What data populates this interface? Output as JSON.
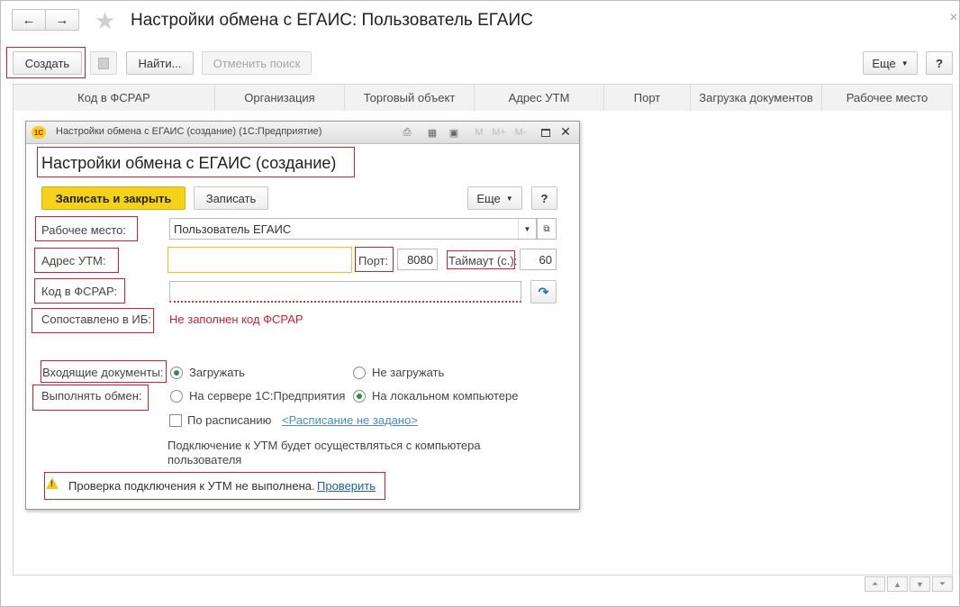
{
  "window": {
    "title": "Настройки обмена с ЕГАИС: Пользователь ЕГАИС"
  },
  "nav": {
    "back_glyph": "←",
    "forward_glyph": "→",
    "star_glyph": "★"
  },
  "toolbar": {
    "create": "Создать",
    "find": "Найти...",
    "cancel_search": "Отменить поиск",
    "more": "Еще",
    "help": "?"
  },
  "list": {
    "columns": [
      "Код в ФСРАР",
      "Организация",
      "Торговый объект",
      "Адрес УТМ",
      "Порт",
      "Загрузка документов",
      "Рабочее место"
    ]
  },
  "dialog": {
    "window_title": "Настройки обмена с ЕГАИС (создание)  (1С:Предприятие)",
    "heading": "Настройки обмена с ЕГАИС (создание)",
    "toolbar": {
      "save_close": "Записать и закрыть",
      "save": "Записать",
      "more": "Еще",
      "help": "?"
    },
    "workplace": {
      "label": "Рабочее место:",
      "value": "Пользователь ЕГАИС"
    },
    "utm": {
      "label": "Адрес УТМ:",
      "value": "",
      "port_label": "Порт:",
      "port": "8080",
      "timeout_label": "Таймаут (с.):",
      "timeout": "60"
    },
    "fsrar": {
      "label": "Код в ФСРАР:",
      "value": ""
    },
    "matched": {
      "label": "Сопоставлено в ИБ:",
      "value": "Не заполнен код ФСРАР"
    },
    "incoming": {
      "label": "Входящие документы:",
      "opt_load": "Загружать",
      "opt_noload": "Не загружать",
      "selected": "load"
    },
    "exchange": {
      "label": "Выполнять обмен:",
      "opt_server": "На сервере 1С:Предприятия",
      "opt_local": "На локальном компьютере",
      "selected": "local"
    },
    "schedule": {
      "checkbox_label": "По расписанию",
      "link": "<Расписание не задано>"
    },
    "info_text": "Подключение к УТМ будет осуществляться с компьютера пользователя",
    "warning": {
      "text": "Проверка подключения к УТМ не выполнена.",
      "link": "Проверить"
    }
  },
  "colors": {
    "accent_yellow": "#f5d21a",
    "error_red": "#d01f2f",
    "link_blue": "#1f5fa8",
    "radio_green": "#2f8f3f"
  }
}
